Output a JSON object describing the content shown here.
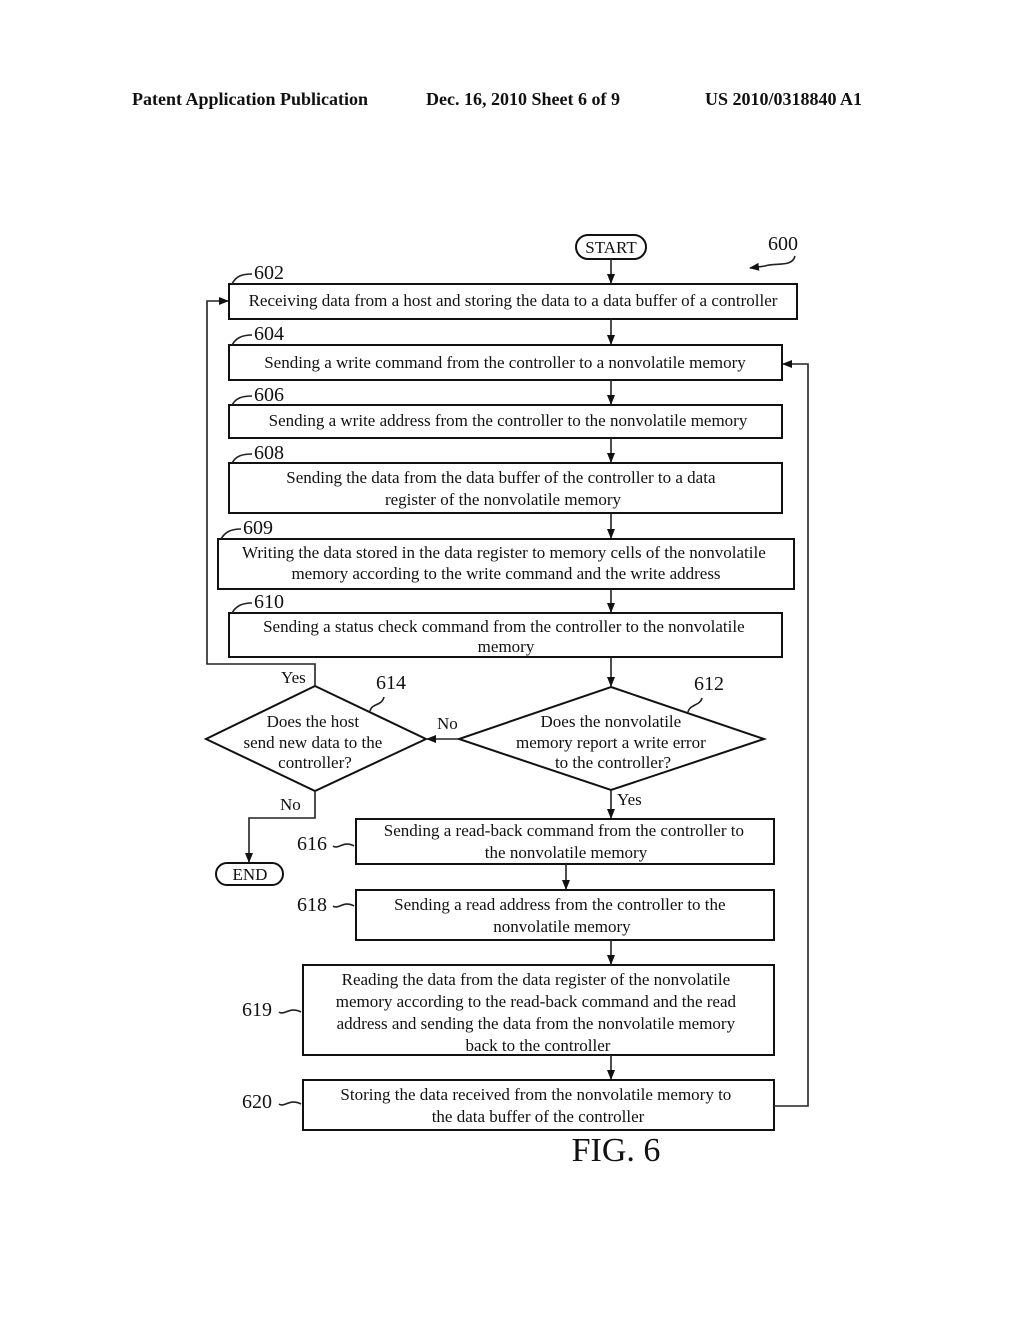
{
  "header": {
    "publication": "Patent Application Publication",
    "date_sheet": "Dec. 16, 2010   Sheet 6 of 9",
    "number": "US 2010/0318840 A1"
  },
  "diagram": {
    "ref": "600",
    "start": "START",
    "end": "END",
    "figure_label": "FIG. 6",
    "steps": {
      "s602": {
        "ref": "602",
        "lines": [
          "Receiving data from a host and storing the data to a data buffer of a controller"
        ]
      },
      "s604": {
        "ref": "604",
        "lines": [
          "Sending a write command from the controller to a nonvolatile memory"
        ]
      },
      "s606": {
        "ref": "606",
        "lines": [
          "Sending a write address from the controller to the nonvolatile memory"
        ]
      },
      "s608": {
        "ref": "608",
        "lines": [
          "Sending the data from the data buffer of the controller to a data",
          "register of the nonvolatile memory"
        ]
      },
      "s609": {
        "ref": "609",
        "lines": [
          "Writing the data stored in the data register to memory cells of the nonvolatile",
          "memory according to the write command and the write address"
        ]
      },
      "s610": {
        "ref": "610",
        "lines": [
          "Sending a status check command from the controller to the nonvolatile",
          "memory"
        ]
      },
      "s616": {
        "ref": "616",
        "lines": [
          "Sending a read-back command from the controller to",
          "the nonvolatile memory"
        ]
      },
      "s618": {
        "ref": "618",
        "lines": [
          "Sending a read address from the controller to the",
          "nonvolatile memory"
        ]
      },
      "s619": {
        "ref": "619",
        "lines": [
          "Reading the data from the data register of the nonvolatile",
          "memory according to the read-back command and the read",
          "address and sending the data from the nonvolatile memory",
          "back to the controller"
        ]
      },
      "s620": {
        "ref": "620",
        "lines": [
          "Storing the data received from the nonvolatile memory to",
          "the data buffer of the controller"
        ]
      }
    },
    "decisions": {
      "d612": {
        "ref": "612",
        "lines": [
          "Does the nonvolatile",
          "memory report a write error",
          "to the controller?"
        ]
      },
      "d614": {
        "ref": "614",
        "lines": [
          "Does the host",
          "send new data to the",
          "controller?"
        ]
      }
    },
    "edge_labels": {
      "d612_no": "No",
      "d612_yes": "Yes",
      "d614_yes": "Yes",
      "d614_no": "No"
    }
  }
}
